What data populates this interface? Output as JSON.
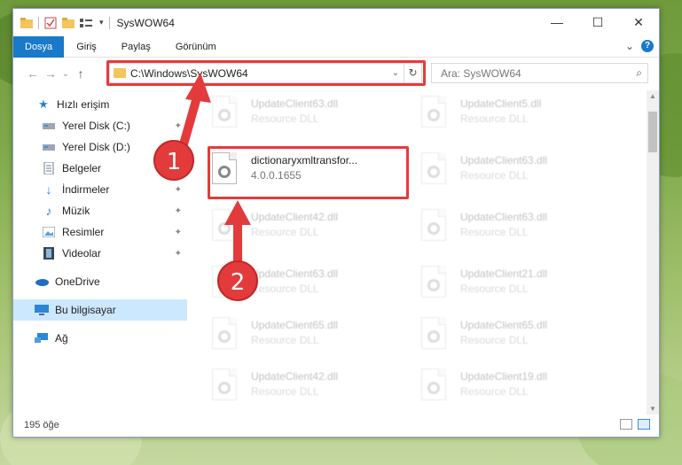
{
  "window": {
    "title": "SysWOW64",
    "controls": {
      "minimize": "—",
      "maximize": "☐",
      "close": "✕"
    }
  },
  "ribbon": {
    "tabs": [
      "Dosya",
      "Giriş",
      "Paylaş",
      "Görünüm"
    ],
    "expand_glyph": "⌄",
    "help_glyph": "?"
  },
  "nav": {
    "back": "←",
    "forward": "→",
    "recent": "⌄",
    "up": "↑",
    "address": "C:\\Windows\\SysWOW64",
    "address_dropdown": "⌄",
    "refresh": "↻",
    "search_placeholder": "Ara: SysWOW64",
    "search_glyph": "⌕"
  },
  "sidebar": {
    "items": [
      {
        "label": "Hızlı erişim",
        "icon": "star-icon",
        "pinned": false,
        "selected": false
      },
      {
        "label": "Yerel Disk (C:)",
        "icon": "drive-icon",
        "pinned": true,
        "selected": false
      },
      {
        "label": "Yerel Disk (D:)",
        "icon": "drive-icon",
        "pinned": true,
        "selected": false
      },
      {
        "label": "Belgeler",
        "icon": "documents-icon",
        "pinned": true,
        "selected": false
      },
      {
        "label": "İndirmeler",
        "icon": "download-icon",
        "pinned": true,
        "selected": false
      },
      {
        "label": "Müzik",
        "icon": "music-icon",
        "pinned": true,
        "selected": false
      },
      {
        "label": "Resimler",
        "icon": "pictures-icon",
        "pinned": true,
        "selected": false
      },
      {
        "label": "Videolar",
        "icon": "videos-icon",
        "pinned": true,
        "selected": false
      },
      {
        "label": "OneDrive",
        "icon": "cloud-icon",
        "pinned": false,
        "selected": false
      },
      {
        "label": "Bu bilgisayar",
        "icon": "computer-icon",
        "pinned": false,
        "selected": true
      },
      {
        "label": "Ağ",
        "icon": "network-icon",
        "pinned": false,
        "selected": false
      }
    ],
    "pin_glyph": "📌"
  },
  "files": {
    "highlighted": {
      "name": "dictionaryxmltransfor...",
      "version": "4.0.0.1655"
    },
    "left_column": [
      {
        "name": "UpdateClient63.dll",
        "type": "Resource DLL"
      },
      {
        "name": "UpdateClient42.dll",
        "type": "Resource DLL"
      },
      {
        "name": "UpdateClient63.dll",
        "type": "Resource DLL"
      },
      {
        "name": "UpdateClient65.dll",
        "type": "Resource DLL"
      },
      {
        "name": "UpdateClient42.dll",
        "type": "Resource DLL"
      }
    ],
    "right_column": [
      {
        "name": "UpdateClient5.dll",
        "type": "Resource DLL"
      },
      {
        "name": "UpdateClient63.dll",
        "type": "Resource DLL"
      },
      {
        "name": "UpdateClient63.dll",
        "type": "Resource DLL"
      },
      {
        "name": "UpdateClient21.dll",
        "type": "Resource DLL"
      },
      {
        "name": "UpdateClient65.dll",
        "type": "Resource DLL"
      },
      {
        "name": "UpdateClient19.dll",
        "type": "Resource DLL"
      }
    ]
  },
  "status": {
    "item_count": "195 öğe"
  },
  "callouts": [
    "1",
    "2"
  ],
  "colors": {
    "accent": "#1979ca",
    "highlight": "#e53b3b",
    "selected": "#cce8ff"
  }
}
